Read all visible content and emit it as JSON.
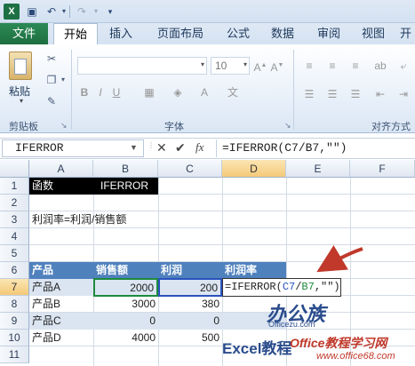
{
  "app": {
    "logo": "X"
  },
  "tabs": [
    "文件",
    "开始",
    "插入",
    "页面布局",
    "公式",
    "数据",
    "审阅",
    "视图",
    "开"
  ],
  "ribbon": {
    "paste_label": "粘贴",
    "clipboard_label": "剪贴板",
    "font_size": "10",
    "font_label": "字体",
    "align_label": "对齐方式",
    "wrap_icon": "wrap-text-icon"
  },
  "formula_bar": {
    "name_box": "IFERROR",
    "fx": "fx",
    "formula": "=IFERROR(C7/B7,\"\")"
  },
  "columns": [
    "A",
    "B",
    "C",
    "D",
    "E",
    "F"
  ],
  "rows": [
    "1",
    "2",
    "3",
    "4",
    "5",
    "6",
    "7",
    "8",
    "9",
    "10",
    "11"
  ],
  "cells": {
    "a1": "函数",
    "b1": "IFERROR",
    "a3": "利润率=利润/销售额",
    "h6a": "产品",
    "h6b": "销售额",
    "h6c": "利润",
    "h6d": "利润率",
    "a7": "产品A",
    "b7": "2000",
    "c7": "200",
    "a8": "产品B",
    "b8": "3000",
    "c8": "380",
    "a9": "产品C",
    "b9": "0",
    "c9": "0",
    "a10": "产品D",
    "b10": "4000",
    "c10": "500"
  },
  "edit": {
    "p1": "=IFERROR(",
    "p2": "C7",
    "p3": "/",
    "p4": "B7",
    "p5": ",\"\")"
  },
  "watermark": {
    "top": "办公族",
    "sub": "Officezu.com",
    "excel": "Excel教程",
    "office": "Office教程学习网",
    "url": "www.office68.com"
  }
}
